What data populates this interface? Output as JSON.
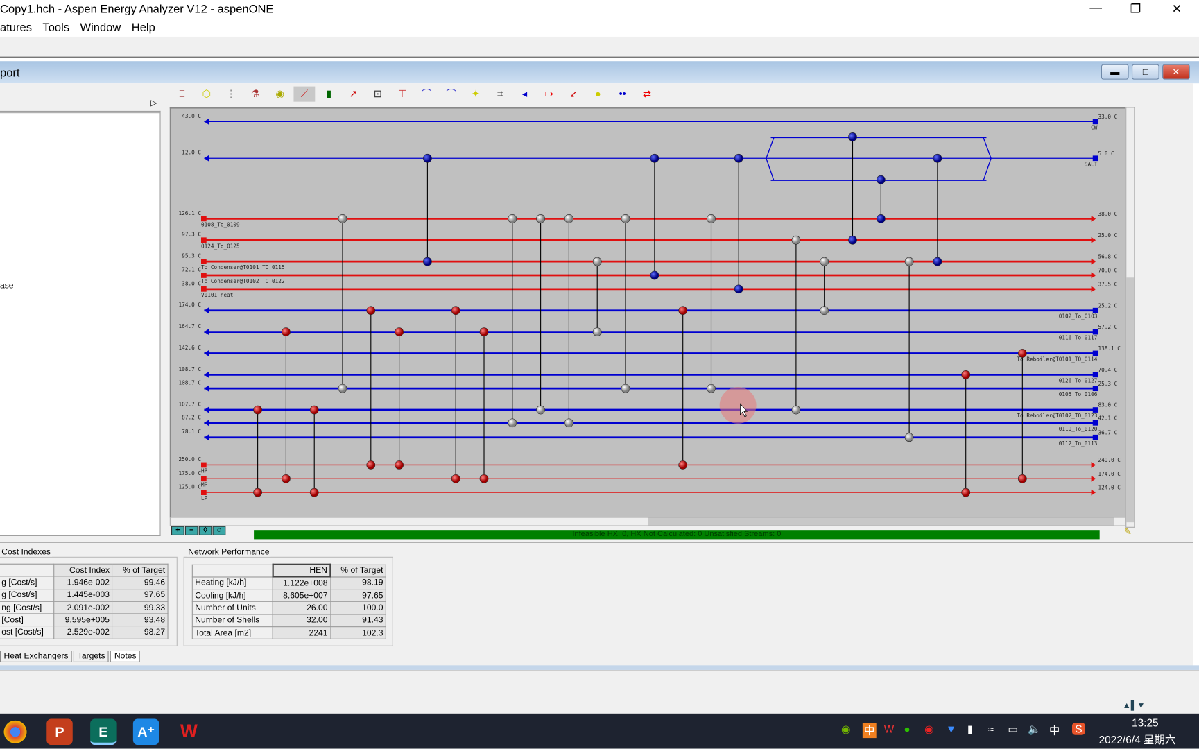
{
  "window": {
    "title": "Copy1.hch - Aspen Energy Analyzer V12 - aspenONE",
    "controls": [
      "minimize",
      "restore",
      "close"
    ]
  },
  "menu": [
    "atures",
    "Tools",
    "Window",
    "Help"
  ],
  "child": {
    "title": "port",
    "left_pane_text": "ase"
  },
  "toolbar_icons": [
    "hen-grid-icon",
    "ring-icon",
    "dotted-grid-icon",
    "flask-icon",
    "stack-icon",
    "curve-icon",
    "bar-chart-icon",
    "diagonal-arrow-icon",
    "loop-icon",
    "split-icon",
    "curve-split-icon",
    "curve-split-2-icon",
    "yellow-node-icon",
    "vertical-node-icon",
    "left-node-icon",
    "red-arrow-icon",
    "red-diag-icon",
    "yellow-dot-icon",
    "dot-pair-icon",
    "swap-arrows-icon"
  ],
  "colors": {
    "hot": "#e01010",
    "cold": "#0000d0",
    "canvas": "#c0c0c0",
    "status": "#008000"
  },
  "streams": [
    {
      "name": "CW",
      "type": "cold-utility",
      "left_temp": "43.0 C",
      "right_temp": "33.0 C"
    },
    {
      "name": "SALT",
      "type": "cold-utility",
      "left_temp": "12.0 C",
      "right_temp": "5.0 C"
    },
    {
      "name": "0108_To_0109",
      "type": "hot",
      "left_temp": "126.1 C",
      "right_temp": "38.0 C"
    },
    {
      "name": "0124_To_0125",
      "type": "hot",
      "left_temp": "97.3 C",
      "right_temp": "25.0 C"
    },
    {
      "name": "To Condenser@T0101_TO_0115",
      "type": "hot",
      "left_temp": "95.3 C",
      "right_temp": "56.8 C"
    },
    {
      "name": "To Condenser@T0102_TO_0122",
      "type": "hot",
      "left_temp": "72.1 C",
      "right_temp": "70.0 C"
    },
    {
      "name": "V0101_heat",
      "type": "hot",
      "left_temp": "38.0 C",
      "right_temp": "37.5 C"
    },
    {
      "name": "0102_To_0103",
      "type": "cold",
      "left_temp": "174.0 C",
      "right_temp": "25.2 C"
    },
    {
      "name": "0116_To_0117",
      "type": "cold",
      "left_temp": "164.7 C",
      "right_temp": "57.2 C"
    },
    {
      "name": "To Reboiler@T0101_TO_0114",
      "type": "cold",
      "left_temp": "142.6 C",
      "right_temp": "138.1 C"
    },
    {
      "name": "0126_To_0127",
      "type": "cold",
      "left_temp": "108.7 C",
      "right_temp": "70.4 C"
    },
    {
      "name": "0105_To_0106",
      "type": "cold",
      "left_temp": "108.7 C",
      "right_temp": "25.3 C"
    },
    {
      "name": "To Reboiler@T0102_TO_0123",
      "type": "cold",
      "left_temp": "107.7 C",
      "right_temp": "83.0 C"
    },
    {
      "name": "0119_To_0120",
      "type": "cold",
      "left_temp": "87.2 C",
      "right_temp": "42.1 C"
    },
    {
      "name": "0112_To_0113",
      "type": "cold",
      "left_temp": "78.1 C",
      "right_temp": "36.7 C"
    },
    {
      "name": "HP",
      "type": "hot-utility",
      "left_temp": "250.0 C",
      "right_temp": "249.0 C"
    },
    {
      "name": "MP",
      "type": "hot-utility",
      "left_temp": "175.0 C",
      "right_temp": "174.0 C"
    },
    {
      "name": "LP",
      "type": "hot-utility",
      "left_temp": "125.0 C",
      "right_temp": "124.0 C"
    }
  ],
  "exchangers": [
    {
      "kind": "cooler",
      "from": 1,
      "to": 4
    },
    {
      "kind": "cooler",
      "from": 1,
      "to": 5
    },
    {
      "kind": "cooler",
      "from": 1,
      "to": 6
    },
    {
      "kind": "cooler",
      "from": 1,
      "to": 3,
      "split": true
    },
    {
      "kind": "cooler",
      "from": 1,
      "to": 2,
      "split": true
    },
    {
      "kind": "cooler",
      "from": 1,
      "to": 4
    },
    {
      "kind": "process",
      "from": 2,
      "to": 11
    },
    {
      "kind": "process",
      "from": 2,
      "to": 13
    },
    {
      "kind": "process",
      "from": 2,
      "to": 12
    },
    {
      "kind": "process",
      "from": 2,
      "to": 13
    },
    {
      "kind": "process",
      "from": 2,
      "to": 11
    },
    {
      "kind": "process",
      "from": 2,
      "to": 11
    },
    {
      "kind": "process",
      "from": 4,
      "to": 8
    },
    {
      "kind": "process",
      "from": 3,
      "to": 12
    },
    {
      "kind": "process",
      "from": 4,
      "to": 7
    },
    {
      "kind": "process",
      "from": 4,
      "to": 14
    },
    {
      "kind": "heater",
      "from": 12,
      "to": 17
    },
    {
      "kind": "heater",
      "from": 8,
      "to": 16
    },
    {
      "kind": "heater",
      "from": 12,
      "to": 17
    },
    {
      "kind": "heater",
      "from": 7,
      "to": 15
    },
    {
      "kind": "heater",
      "from": 8,
      "to": 15
    },
    {
      "kind": "heater",
      "from": 7,
      "to": 16
    },
    {
      "kind": "heater",
      "from": 8,
      "to": 16
    },
    {
      "kind": "heater",
      "from": 7,
      "to": 15
    },
    {
      "kind": "heater",
      "from": 10,
      "to": 17
    },
    {
      "kind": "heater",
      "from": 9,
      "to": 16
    }
  ],
  "status_text": "Infeasible HX: 0, HX Not Calculated: 0     Unsatisfied Streams: 0",
  "cost_indexes": {
    "title": "Cost Indexes",
    "headers": [
      "",
      "Cost Index",
      "% of Target"
    ],
    "rows": [
      [
        "g [Cost/s]",
        "1.946e-002",
        "99.46"
      ],
      [
        "g [Cost/s]",
        "1.445e-003",
        "97.65"
      ],
      [
        "ng [Cost/s]",
        "2.091e-002",
        "99.33"
      ],
      [
        "[Cost]",
        "9.595e+005",
        "93.48"
      ],
      [
        "ost [Cost/s]",
        "2.529e-002",
        "98.27"
      ]
    ]
  },
  "network_performance": {
    "title": "Network Performance",
    "headers": [
      "",
      "HEN",
      "% of Target"
    ],
    "rows": [
      [
        "Heating [kJ/h]",
        "1.122e+008",
        "98.19"
      ],
      [
        "Cooling [kJ/h]",
        "8.605e+007",
        "97.65"
      ],
      [
        "Number of Units",
        "26.00",
        "100.0"
      ],
      [
        "Number of Shells",
        "32.00",
        "91.43"
      ],
      [
        "Total Area [m2]",
        "2241",
        "102.3"
      ]
    ]
  },
  "tabs": [
    "Heat Exchangers",
    "Targets",
    "Notes"
  ],
  "taskbar": {
    "apps": [
      {
        "name": "chrome",
        "label": ""
      },
      {
        "name": "powerpoint",
        "label": "P"
      },
      {
        "name": "energy-analyzer",
        "label": "E"
      },
      {
        "name": "a-plus",
        "label": "A⁺"
      },
      {
        "name": "wps",
        "label": "W"
      }
    ],
    "tray": [
      "中",
      "中"
    ],
    "time": "13:25",
    "date": "2022/6/4 星期六"
  }
}
